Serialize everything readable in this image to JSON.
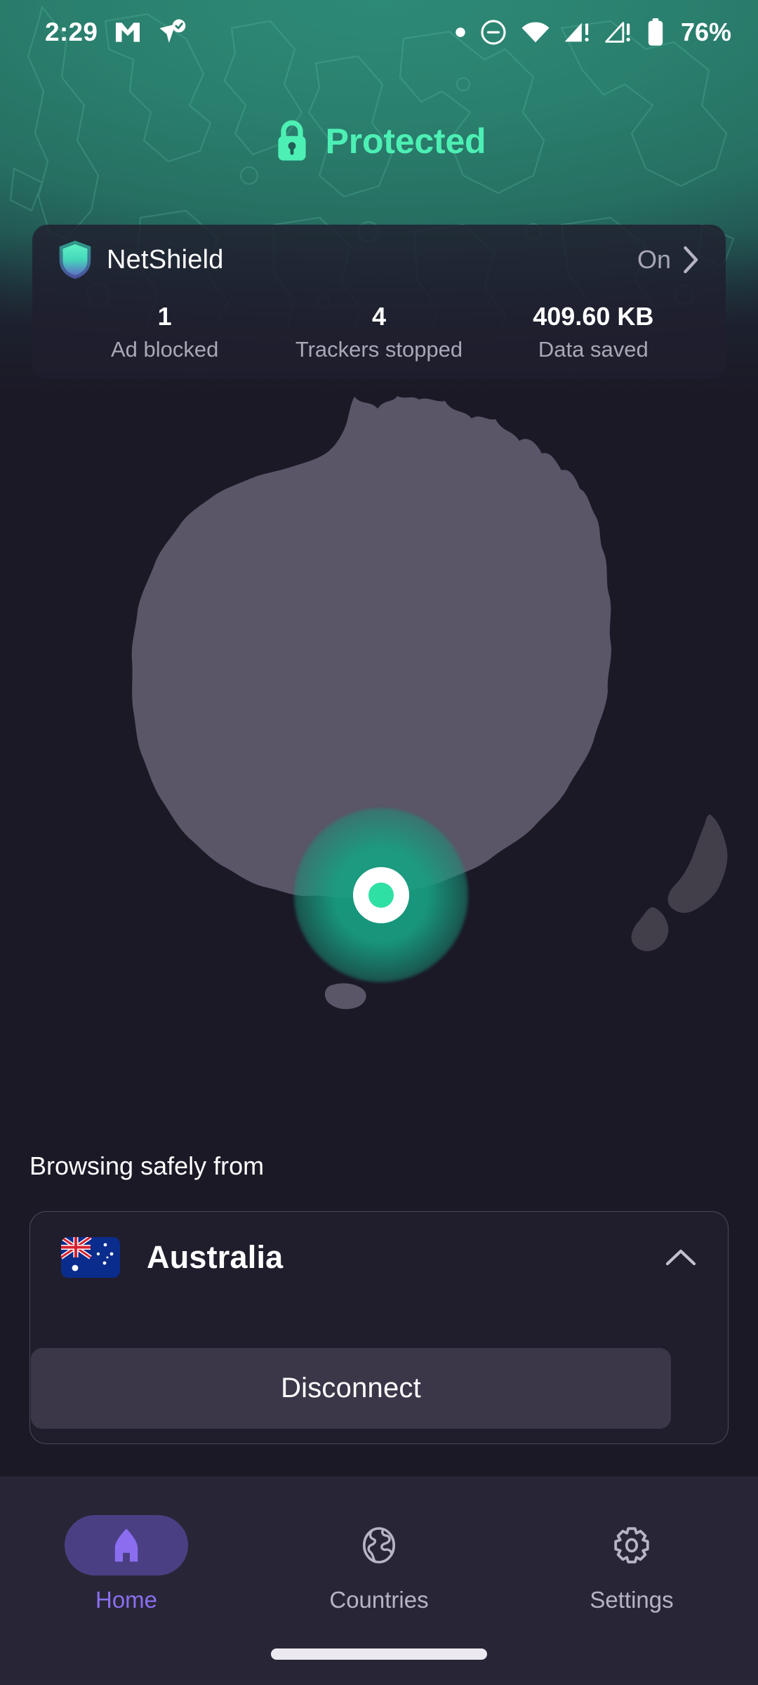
{
  "statusbar": {
    "time": "2:29",
    "battery_pct": "76%",
    "icons": [
      "gmail-icon",
      "location-verified-icon",
      "dot-indicator-icon",
      "do-not-disturb-icon",
      "wifi-icon",
      "cellular-alert-icon",
      "cellular-alert-2-icon",
      "battery-icon"
    ]
  },
  "header": {
    "status_title": "Protected",
    "status_color": "#4df0b4",
    "lock_icon": "lock-icon"
  },
  "netshield": {
    "title": "NetShield",
    "shield_icon": "shield-icon",
    "state": "On",
    "chevron_icon": "chevron-right-icon",
    "stats": [
      {
        "value": "1",
        "label": "Ad blocked"
      },
      {
        "value": "4",
        "label": "Trackers stopped"
      },
      {
        "value": "409.60 KB",
        "label": "Data saved"
      }
    ]
  },
  "map": {
    "region": "Australia",
    "landmass_color": "#5a5567",
    "background_color": "#1b1926",
    "pin_color": "#2fe0a4",
    "pin_halo_color": "#18a082"
  },
  "connection": {
    "browsing_label": "Browsing safely from",
    "country": "Australia",
    "flag_icon": "australia-flag-icon",
    "collapse_icon": "chevron-up-icon",
    "disconnect_label": "Disconnect"
  },
  "bottomnav": {
    "items": [
      {
        "label": "Home",
        "icon": "home-icon",
        "active": true
      },
      {
        "label": "Countries",
        "icon": "globe-icon",
        "active": false
      },
      {
        "label": "Settings",
        "icon": "gear-icon",
        "active": false
      }
    ],
    "active_color": "#8b6ef0"
  }
}
